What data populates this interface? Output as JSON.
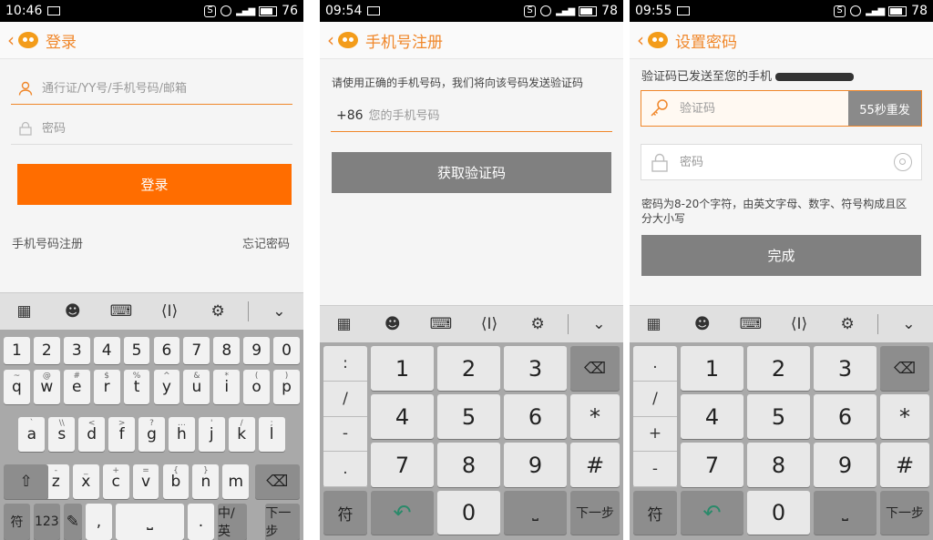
{
  "screens": [
    {
      "status": {
        "time": "10:46",
        "battery": "76"
      },
      "title": "登录",
      "account_placeholder": "通行证/YY号/手机号码/邮箱",
      "password_placeholder": "密码",
      "login_button": "登录",
      "register_link": "手机号码注册",
      "forgot_link": "忘记密码"
    },
    {
      "status": {
        "time": "09:54",
        "battery": "78"
      },
      "title": "手机号注册",
      "instruction": "请使用正确的手机号码，我们将向该号码发送验证码",
      "country_code": "+86",
      "phone_placeholder": "您的手机号码",
      "get_code_button": "获取验证码"
    },
    {
      "status": {
        "time": "09:55",
        "battery": "78"
      },
      "title": "设置密码",
      "sent_notice": "验证码已发送至您的手机",
      "code_placeholder": "验证码",
      "resend_label": "55秒重发",
      "password_placeholder": "密码",
      "password_rule": "密码为8-20个字符，由英文字母、数字、符号构成且区分大小写",
      "done_button": "完成"
    }
  ],
  "keyboard": {
    "numbers_row": [
      "1",
      "2",
      "3",
      "4",
      "5",
      "6",
      "7",
      "8",
      "9",
      "0"
    ],
    "qwerty": [
      {
        "row": [
          "q",
          "w",
          "e",
          "r",
          "t",
          "y",
          "u",
          "i",
          "o",
          "p"
        ],
        "alt": [
          "~",
          "@",
          "#",
          "$",
          "%",
          "^",
          "&",
          "*",
          "(",
          ")"
        ]
      },
      {
        "row": [
          "a",
          "s",
          "d",
          "f",
          "g",
          "h",
          "j",
          "k",
          "l"
        ],
        "alt": [
          "`",
          "\\\\",
          "<",
          ">",
          "?",
          "…",
          "'",
          "/",
          ";"
        ]
      },
      {
        "row": [
          "z",
          "x",
          "c",
          "v",
          "b",
          "n",
          "m"
        ],
        "alt": [
          "-",
          "_",
          "+",
          "=",
          "{",
          "}",
          ""
        ]
      }
    ],
    "bottom": {
      "sym": "符",
      "num": "123",
      "comma": ",",
      "period": ".",
      "lang": "中/英",
      "next": "下一步"
    },
    "numpad": {
      "digits": [
        "1",
        "2",
        "3",
        "4",
        "5",
        "6",
        "7",
        "8",
        "9",
        "0"
      ],
      "symbols_p2": [
        ":",
        "/",
        "-",
        "."
      ],
      "symbols_p3": [
        ".",
        "/",
        "+",
        "-"
      ],
      "star": "*",
      "hash": "#",
      "sym": "符",
      "next": "下一步"
    }
  }
}
